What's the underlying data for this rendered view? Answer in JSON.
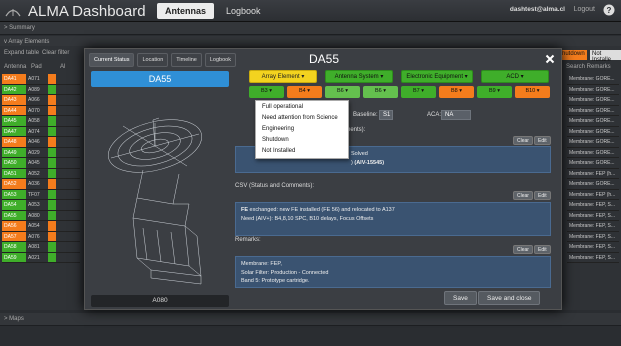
{
  "app": {
    "title": "ALMA Dashboard"
  },
  "nav": {
    "tabs": [
      {
        "label": "Antennas"
      },
      {
        "label": "Logbook"
      }
    ]
  },
  "user": {
    "email": "dashtest@alma.cl",
    "logout_label": "Logout"
  },
  "background": {
    "summary_label": "> Summary",
    "array_elements_label": "v Array Elements",
    "expand_label": "Expand table",
    "clear_label": "Clear filter",
    "col_antenna": "Antenna",
    "col_pad": "Pad",
    "col_extra": "Al",
    "search_placeholder": "Search Remarks",
    "shutdown_badge": "hutdown",
    "not_installed_badge": "Not Installe",
    "maps_label": "> Maps",
    "rows": [
      {
        "antenna": "DA41",
        "pad": "A071",
        "status": "#f47c1c"
      },
      {
        "antenna": "DA42",
        "pad": "A089",
        "status": "#3fae2a"
      },
      {
        "antenna": "DA43",
        "pad": "A066",
        "status": "#f47c1c"
      },
      {
        "antenna": "DA44",
        "pad": "A070",
        "status": "#f47c1c"
      },
      {
        "antenna": "DA45",
        "pad": "A058",
        "status": "#3fae2a"
      },
      {
        "antenna": "DA47",
        "pad": "A074",
        "status": "#3fae2a"
      },
      {
        "antenna": "DA48",
        "pad": "A046",
        "status": "#f47c1c"
      },
      {
        "antenna": "DA49",
        "pad": "A029",
        "status": "#3fae2a"
      },
      {
        "antenna": "DA50",
        "pad": "A045",
        "status": "#3fae2a"
      },
      {
        "antenna": "DA51",
        "pad": "A052",
        "status": "#3fae2a"
      },
      {
        "antenna": "DA52",
        "pad": "A036",
        "status": "#f47c1c"
      },
      {
        "antenna": "DA53",
        "pad": "TF07",
        "status": "#3fae2a"
      },
      {
        "antenna": "DA54",
        "pad": "A053",
        "status": "#3fae2a"
      },
      {
        "antenna": "DA55",
        "pad": "A080",
        "status": "#3fae2a"
      },
      {
        "antenna": "DA56",
        "pad": "A054",
        "status": "#f47c1c"
      },
      {
        "antenna": "DA57",
        "pad": "A076",
        "status": "#f47c1c"
      },
      {
        "antenna": "DA58",
        "pad": "A081",
        "status": "#3fae2a"
      },
      {
        "antenna": "DA59",
        "pad": "A021",
        "status": "#3fae2a"
      }
    ],
    "right_rows": [
      "Membrane: GORE...",
      "Membrane: GORE...",
      "Membrane: GORE...",
      "Membrane: GORE...",
      "Membrane: GORE...",
      "Membrane: GORE...",
      "Membrane: GORE...",
      "Membrane: GORE...",
      "Membrane: GORE...",
      "Membrane: FEP (h...",
      "Membrane: GORE...",
      "Membrane: FEP (h...",
      "Membrane: FEP, S...",
      "Membrane: FEP, S...",
      "Membrane: FEP, S...",
      "Membrane: FEP, S...",
      "Membrane: FEP, S...",
      "Membrane: FEP, S..."
    ]
  },
  "modal": {
    "title": "DA55",
    "tabs": [
      {
        "label": "Current Status"
      },
      {
        "label": "Location"
      },
      {
        "label": "Timeline"
      },
      {
        "label": "Logbook"
      }
    ],
    "antenna_name": "DA55",
    "pad": "A080",
    "category_buttons": [
      {
        "label": "Array Element ▾",
        "color": "#f3d31f"
      },
      {
        "label": "Antenna System ▾",
        "color": "#3fae2a"
      },
      {
        "label": "Electronic Equipment ▾",
        "color": "#3fae2a"
      },
      {
        "label": "ACD ▾",
        "color": "#3fae2a"
      }
    ],
    "band_buttons": [
      {
        "label": "B3 ▾",
        "color": "#3fae2a"
      },
      {
        "label": "B4 ▾",
        "color": "#f47c1c"
      },
      {
        "label": "B6 ▾",
        "color": "#64c04e"
      },
      {
        "label": "B6 ▾",
        "color": "#64c04e"
      },
      {
        "label": "B7 ▾",
        "color": "#3fae2a"
      },
      {
        "label": "B8 ▾",
        "color": "#f47c1c"
      },
      {
        "label": "B9 ▾",
        "color": "#3fae2a"
      },
      {
        "label": "B10 ▾",
        "color": "#f47c1c"
      }
    ],
    "dropdown_options": [
      "Full operational",
      "Need attention from Science",
      "Engineering",
      "Shutdown",
      "Not Installed"
    ],
    "baseline_label": "Baseline:",
    "baseline_value": "S1",
    "aca_label": "ACA:",
    "aca_value": "NA",
    "status_comments_label": "nents):",
    "status_text_line1": "Solved",
    "status_text_line2_prefix": ")",
    "status_text_line2_bold": "(AIV-15545)",
    "csv_label": "CSV (Status and Comments):",
    "csv_line1_bold": "FE",
    "csv_line1_rest": " exchanged: new FE installed (FE 56) and relocated to A137",
    "csv_line2": "Need (AIV+): B4,8,10 SPC, B10 delays, Focus Offsets",
    "remarks_label": "Remarks:",
    "remarks_lines": [
      "Membrane: FEP,",
      "Solar Filter: Production - Connected",
      "Band 5: Prototype cartridge."
    ],
    "clear_label": "Clear",
    "edit_label": "Edit",
    "save_label": "Save",
    "save_close_label": "Save and close"
  }
}
